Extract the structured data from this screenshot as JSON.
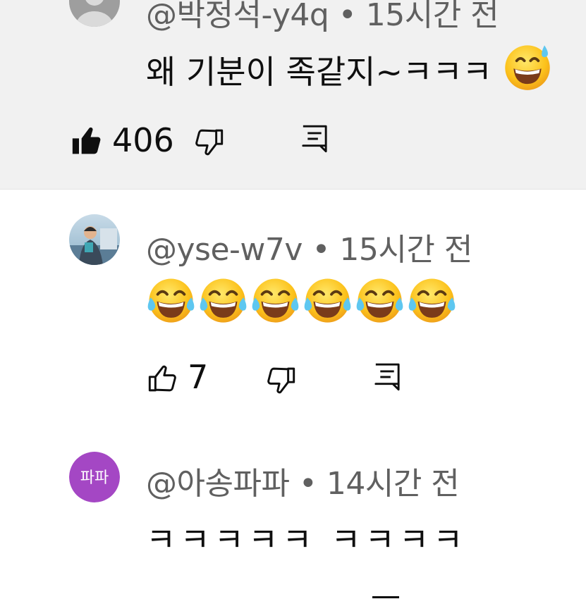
{
  "comments": [
    {
      "author": "@박정석-y4q",
      "separator": "•",
      "time": "15시간 전",
      "text": "왜 기분이 족같지~ㅋㅋㅋ",
      "text_emoji": "grinning-face-with-sweat",
      "likes": "406",
      "liked": true
    },
    {
      "author": "@yse-w7v",
      "separator": "•",
      "time": "15시간 전",
      "emojis": [
        "tears-of-joy",
        "tears-of-joy",
        "tears-of-joy",
        "tears-of-joy",
        "tears-of-joy",
        "tears-of-joy"
      ],
      "likes": "7",
      "liked": false
    },
    {
      "author": "@아송파파",
      "separator": "•",
      "time": "14시간 전",
      "avatar_text": "파파",
      "avatar_color": "#a447c4",
      "text": "ㅋㅋㅋㅋㅋ ㅋㅋㅋㅋ"
    }
  ],
  "colors": {
    "highlight_bg": "#f1f1f1",
    "meta_text": "#606060",
    "text": "#0f0f0f",
    "icon": "#0f0f0f"
  }
}
